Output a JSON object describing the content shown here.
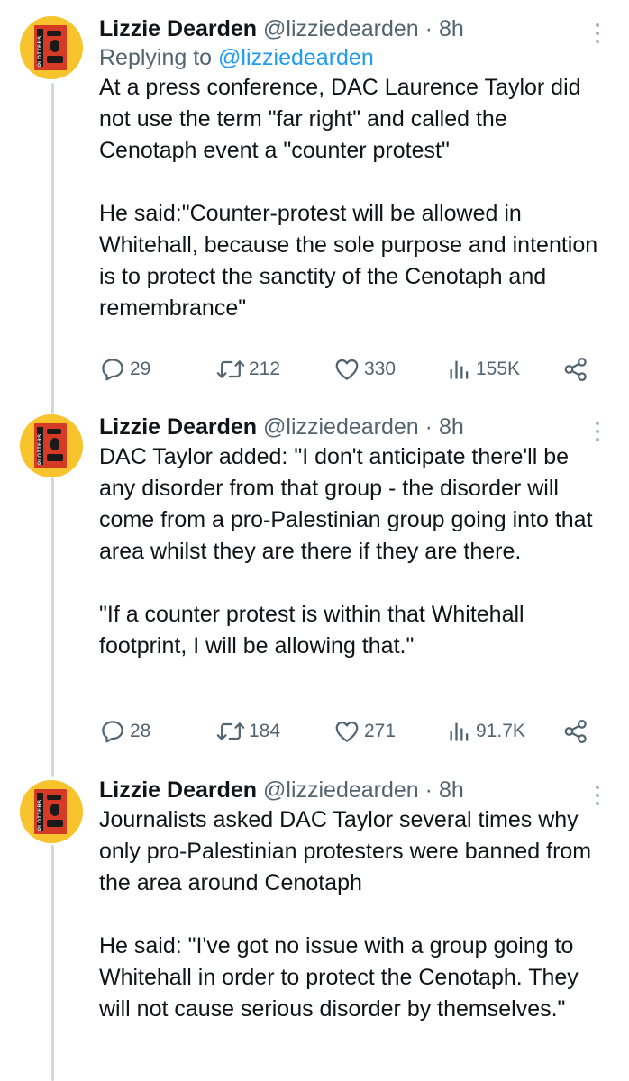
{
  "colors": {
    "name": "#0f1419",
    "secondary": "#536471",
    "link": "#1d9bf0",
    "thread_line": "#cfd9de",
    "avatar_bg": "#f7c42d",
    "book_red": "#d43a26"
  },
  "icons": [
    "reply-icon",
    "retweet-icon",
    "like-icon",
    "views-icon",
    "share-icon",
    "more-icon"
  ],
  "tweets": [
    {
      "name": "Lizzie Dearden",
      "handle": "@lizziedearden",
      "separator": "·",
      "time": "8h",
      "replying_label": "Replying to",
      "replying_handle": "@lizziedearden",
      "avatar_text": "PLOTTERS",
      "body": "At a press conference, DAC Laurence Taylor did not use the term \"far right\" and called the Cenotaph event a \"counter protest\"\n\nHe said:\"Counter-protest will be allowed in Whitehall, because the sole purpose and intention is to protect the sanctity of the Cenotaph and remembrance\"",
      "replies": "29",
      "retweets": "212",
      "likes": "330",
      "views": "155K"
    },
    {
      "name": "Lizzie Dearden",
      "handle": "@lizziedearden",
      "separator": "·",
      "time": "8h",
      "avatar_text": "PLOTTERS",
      "body": "DAC Taylor added: \"I don't anticipate there'll be any disorder from that group - the disorder will come from a pro-Palestinian group going into that area whilst they are there if they are there.\n\n\"If a counter protest is within that Whitehall footprint, I will be allowing that.\"",
      "replies": "28",
      "retweets": "184",
      "likes": "271",
      "views": "91.7K"
    },
    {
      "name": "Lizzie Dearden",
      "handle": "@lizziedearden",
      "separator": "·",
      "time": "8h",
      "avatar_text": "PLOTTERS",
      "body": "Journalists asked DAC Taylor several times why only pro-Palestinian protesters were banned from the area around Cenotaph\n\nHe said: \"I've got no issue with a group going to Whitehall in order to protect the Cenotaph. They will not cause serious disorder by themselves.\""
    }
  ]
}
